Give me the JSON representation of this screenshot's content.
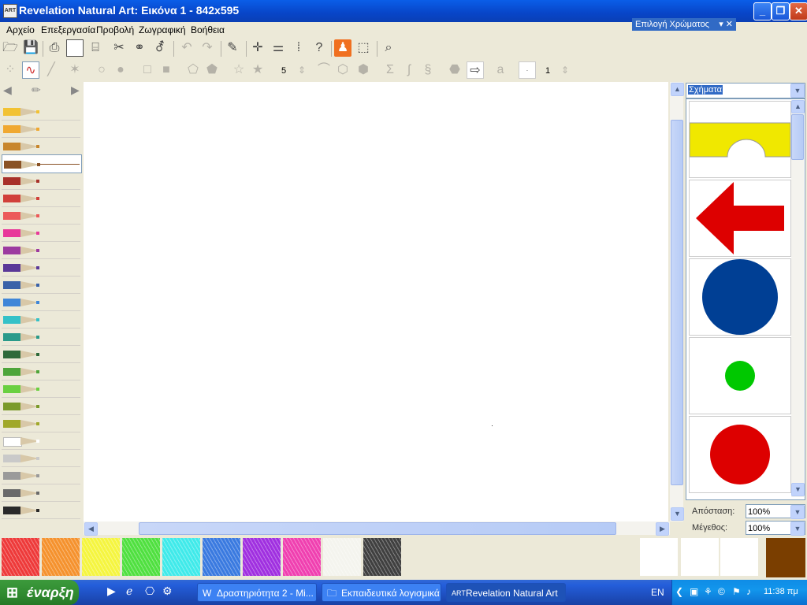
{
  "window": {
    "title": "Revelation Natural Art: Εικόνα 1 - 842x595",
    "app_icon_text": "ART"
  },
  "menu": [
    "Αρχείο",
    "Επεξεργασία",
    "Προβολή",
    "Ζωγραφική",
    "Βοήθεια"
  ],
  "color_picker_tab": "Επιλογή Χρώματος",
  "toolbar2": {
    "sides_value": "5",
    "size_value": "1"
  },
  "pencils": [
    {
      "color": "#f2c233"
    },
    {
      "color": "#f0a830"
    },
    {
      "color": "#c8862c"
    },
    {
      "color": "#8a5226",
      "selected": true
    },
    {
      "color": "#a8312a"
    },
    {
      "color": "#d1403a"
    },
    {
      "color": "#ec5a5a"
    },
    {
      "color": "#e8389a"
    },
    {
      "color": "#9c3aa0"
    },
    {
      "color": "#5a3898"
    },
    {
      "color": "#3a62a8"
    },
    {
      "color": "#3f86d8"
    },
    {
      "color": "#34c1c8"
    },
    {
      "color": "#2a9a8a"
    },
    {
      "color": "#2e6a3a"
    },
    {
      "color": "#4ea53a"
    },
    {
      "color": "#6ad040"
    },
    {
      "color": "#7a9a2a"
    },
    {
      "color": "#a0a82a"
    },
    {
      "color": "#ffffff"
    },
    {
      "color": "#c9c9c9"
    },
    {
      "color": "#9a9a9a"
    },
    {
      "color": "#6a6a6a"
    },
    {
      "color": "#2a2a2a"
    }
  ],
  "shapes_panel": {
    "category": "Σχήματα",
    "shapes": [
      {
        "kind": "arch",
        "color": "#f0e800"
      },
      {
        "kind": "arrow-left",
        "color": "#dd0000"
      },
      {
        "kind": "circle-large",
        "color": "#003f94"
      },
      {
        "kind": "circle-small",
        "color": "#00c800"
      },
      {
        "kind": "circle-medium",
        "color": "#dd0000"
      }
    ],
    "distance_label": "Απόσταση:",
    "distance_value": "100%",
    "size_label": "Μέγεθος:",
    "size_value": "100%"
  },
  "bottom_swatches": [
    "#ee3a3a",
    "#f5922e",
    "#f5f540",
    "#50e040",
    "#40eaea",
    "#3a7ae0",
    "#a030e0",
    "#f040b0",
    "#f4f4ee",
    "#404040"
  ],
  "current_color": "#7a3e00",
  "taskbar": {
    "start_label": "έναρξη",
    "tasks": [
      {
        "label": "Δραστηριότητα 2 - Mi...",
        "active": false
      },
      {
        "label": "Εκπαιδευτικά λογισμικά",
        "active": false
      },
      {
        "label": "Revelation Natural Art",
        "active": true
      }
    ],
    "language": "EN",
    "clock": "11:38 πμ"
  }
}
